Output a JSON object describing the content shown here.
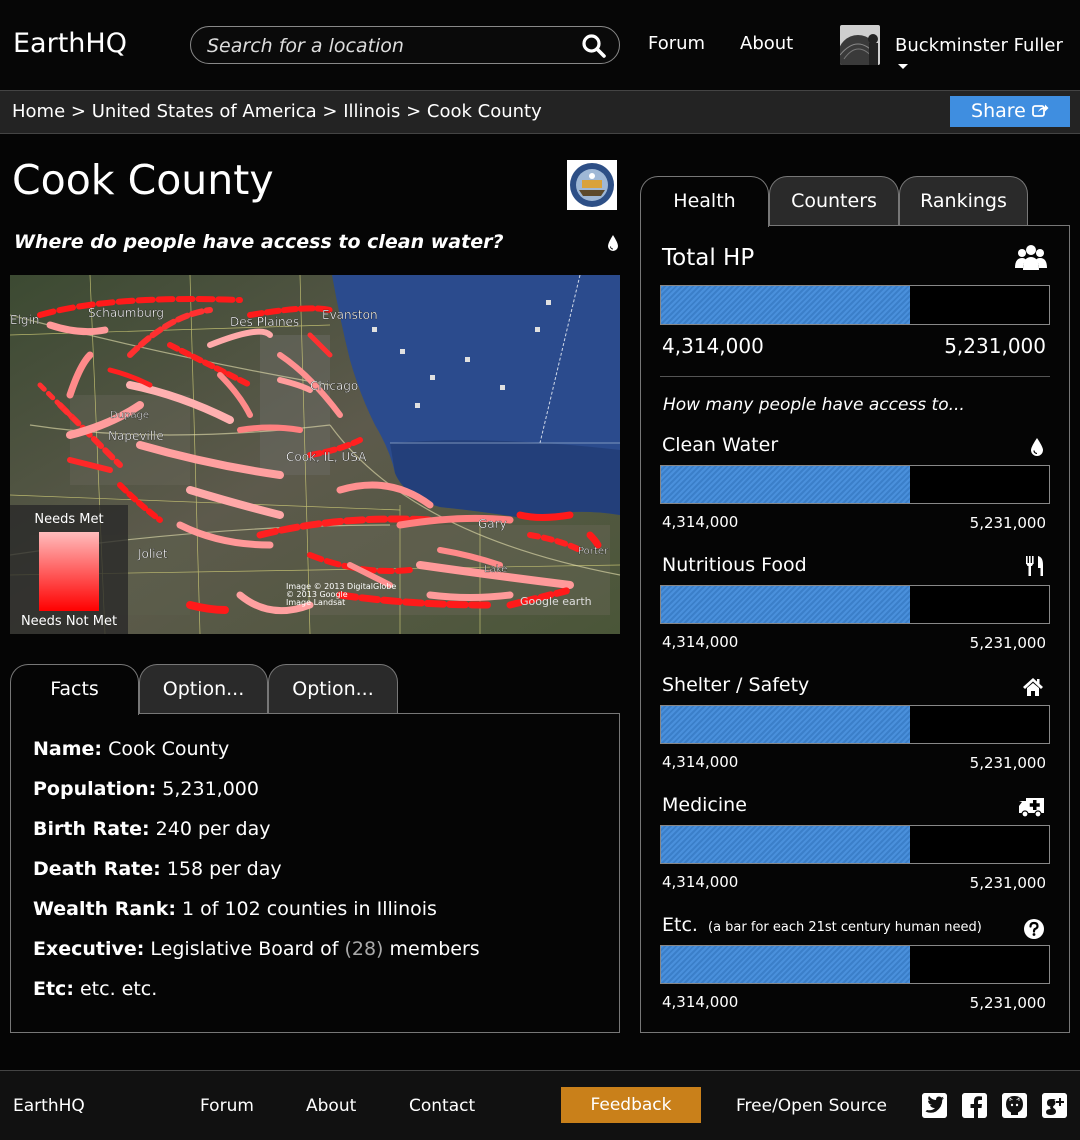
{
  "header": {
    "brand": "EarthHQ",
    "search_placeholder": "Search for a location",
    "nav": [
      "Forum",
      "About"
    ],
    "user_name": "Buckminster Fuller"
  },
  "breadcrumb": {
    "items": [
      "Home",
      "United States of America",
      "Illinois",
      "Cook County"
    ],
    "separator": ">",
    "share_label": "Share"
  },
  "page": {
    "title": "Cook County",
    "question": "Where do people have access to clean water?"
  },
  "map": {
    "places": [
      "Elgin",
      "Schaumburg",
      "Des Plaines",
      "Evanston",
      "Chicago",
      "Napeville",
      "Dupage",
      "Cook, IL, USA",
      "Gary",
      "Joliet",
      "Lake",
      "Porter"
    ],
    "attribution": [
      "Image © 2013 DigitalGlobe",
      "© 2013 Google",
      "Image Landsat"
    ],
    "google_earth": "Google earth",
    "legend_top": "Needs Met",
    "legend_bottom": "Needs Not Met",
    "legend_colors": [
      "#ffbcbc",
      "#ff0000"
    ]
  },
  "facts_tabs": [
    "Facts",
    "Option...",
    "Option..."
  ],
  "facts": [
    {
      "label": "Name:",
      "value": "Cook County"
    },
    {
      "label": "Population:",
      "value": "5,231,000"
    },
    {
      "label": "Birth Rate:",
      "value": "240 per day"
    },
    {
      "label": "Death Rate:",
      "value": "158 per day"
    },
    {
      "label": "Wealth Rank:",
      "value": "1 of 102 counties in Illinois"
    },
    {
      "label": "Executive:",
      "value_pre": "Legislative Board of ",
      "value_muted": "(28)",
      "value_post": " members"
    },
    {
      "label": "Etc:",
      "value": "etc. etc."
    }
  ],
  "right_tabs": [
    "Health",
    "Counters",
    "Rankings"
  ],
  "health": {
    "total_title": "Total HP",
    "total_current": "4,314,000",
    "total_max": "5,231,000",
    "total_fraction": 0.642,
    "question": "How many people have access to...",
    "needs": [
      {
        "label": "Clean Water",
        "icon": "water-drop-icon",
        "current": "4,314,000",
        "max": "5,231,000",
        "fraction": 0.642
      },
      {
        "label": "Nutritious Food",
        "icon": "utensils-icon",
        "current": "4,314,000",
        "max": "5,231,000",
        "fraction": 0.642
      },
      {
        "label": "Shelter / Safety",
        "icon": "home-icon",
        "current": "4,314,000",
        "max": "5,231,000",
        "fraction": 0.642
      },
      {
        "label": "Medicine",
        "icon": "ambulance-icon",
        "current": "4,314,000",
        "max": "5,231,000",
        "fraction": 0.642
      },
      {
        "label": "Etc.",
        "note": "(a bar for each 21st century human need)",
        "icon": "question-icon",
        "current": "4,314,000",
        "max": "5,231,000",
        "fraction": 0.642
      }
    ]
  },
  "footer": {
    "brand": "EarthHQ",
    "links": [
      "Forum",
      "About",
      "Contact"
    ],
    "feedback": "Feedback",
    "open_source": "Free/Open Source",
    "social_icons": [
      "twitter-icon",
      "facebook-icon",
      "github-icon",
      "google-plus-icon"
    ]
  },
  "colors": {
    "accent_blue": "#3f8ee0",
    "bar_fill": "#4a90dc",
    "feedback_orange": "#c9801a",
    "background": "#050505"
  }
}
